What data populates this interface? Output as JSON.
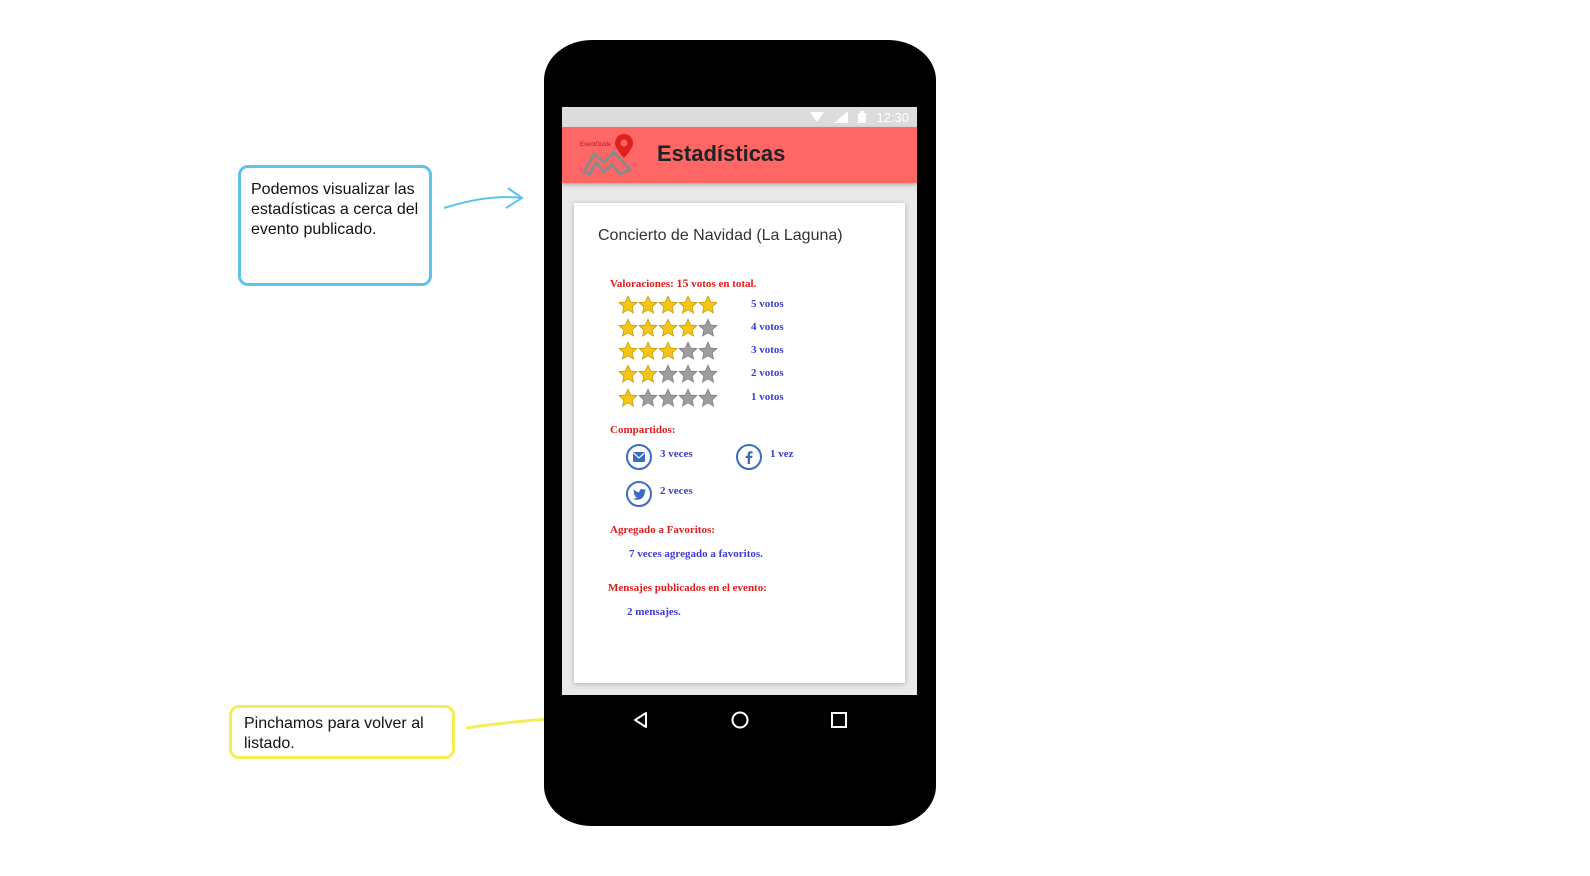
{
  "annotations": {
    "top_note": "Podemos visualizar las estadísticas a cerca del evento publicado.",
    "bottom_note": "Pinchamos para volver al listado."
  },
  "status_bar": {
    "time": "12:30"
  },
  "app_bar": {
    "logo_text": "EventGuide",
    "title": "Estadísticas"
  },
  "event": {
    "title": "Concierto de Navidad (La Laguna)"
  },
  "ratings": {
    "label_prefix": "Valoraciones: ",
    "total": "15",
    "label_suffix": " votos en total.",
    "rows": [
      {
        "stars": 5,
        "votes": "5 votos"
      },
      {
        "stars": 4,
        "votes": "4 votos"
      },
      {
        "stars": 3,
        "votes": "3 votos"
      },
      {
        "stars": 2,
        "votes": "2 votos"
      },
      {
        "stars": 1,
        "votes": "1 votos"
      }
    ]
  },
  "shares": {
    "label": "Compartidos:",
    "email": "3 veces",
    "facebook": "1 vez",
    "twitter": "2 veces"
  },
  "favorites": {
    "label": "Agregado a Favoritos:",
    "text": "7 veces agregado a favoritos."
  },
  "messages": {
    "label": "Mensajes publicados en el evento:",
    "text": "2 mensajes."
  },
  "colors": {
    "app_bar": "#ff6666",
    "section_label": "#e01b1b",
    "value_text": "#3b3bd6",
    "star_filled": "#f5c518",
    "star_empty": "#9e9e9e",
    "note_blue": "#5cc4ec",
    "note_yellow": "#f4ee57"
  }
}
